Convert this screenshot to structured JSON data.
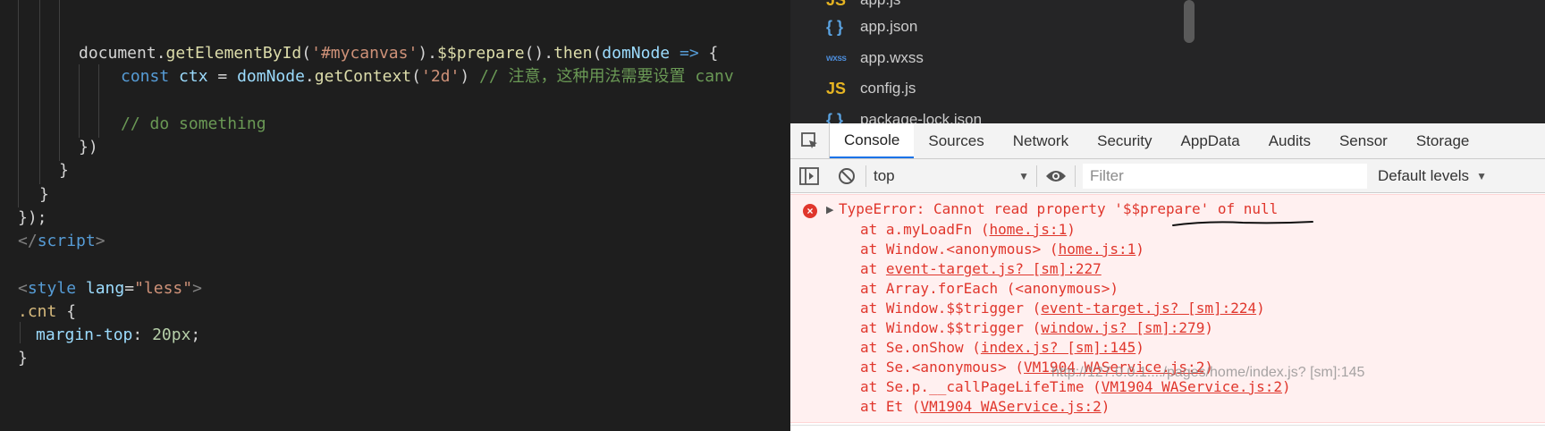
{
  "editor": {
    "lines": [
      {
        "tokens": []
      },
      {
        "tokens": []
      },
      {
        "tokens": [
          {
            "t": "document",
            "c": "plain"
          },
          {
            "t": ".",
            "c": "plain"
          },
          {
            "t": "getElementById",
            "c": "fn"
          },
          {
            "t": "(",
            "c": "plain"
          },
          {
            "t": "'#mycanvas'",
            "c": "str"
          },
          {
            "t": ").",
            "c": "plain"
          },
          {
            "t": "$$prepare",
            "c": "fn"
          },
          {
            "t": "().",
            "c": "plain"
          },
          {
            "t": "then",
            "c": "fn"
          },
          {
            "t": "(",
            "c": "plain"
          },
          {
            "t": "domNode",
            "c": "var"
          },
          {
            "t": " => ",
            "c": "kw"
          },
          {
            "t": "{",
            "c": "plain"
          }
        ]
      },
      {
        "tokens": [
          {
            "t": "const",
            "c": "kw"
          },
          {
            "t": " ",
            "c": "plain"
          },
          {
            "t": "ctx",
            "c": "var"
          },
          {
            "t": " = ",
            "c": "plain"
          },
          {
            "t": "domNode",
            "c": "var"
          },
          {
            "t": ".",
            "c": "plain"
          },
          {
            "t": "getContext",
            "c": "fn"
          },
          {
            "t": "(",
            "c": "plain"
          },
          {
            "t": "'2d'",
            "c": "str"
          },
          {
            "t": ") ",
            "c": "plain"
          },
          {
            "t": "// 注意，这种用法需要设置 canv",
            "c": "cmt"
          }
        ]
      },
      {
        "tokens": []
      },
      {
        "tokens": [
          {
            "t": "// do something",
            "c": "cmt"
          }
        ]
      },
      {
        "tokens": [
          {
            "t": "})",
            "c": "plain"
          }
        ]
      },
      {
        "tokens": [
          {
            "t": "}",
            "c": "plain"
          }
        ]
      },
      {
        "tokens": [
          {
            "t": "}",
            "c": "plain"
          }
        ]
      },
      {
        "tokens": [
          {
            "t": "});",
            "c": "plain"
          }
        ]
      },
      {
        "tokens": [
          {
            "t": "</",
            "c": "tag"
          },
          {
            "t": "script",
            "c": "tagname"
          },
          {
            "t": ">",
            "c": "tag"
          }
        ]
      },
      {
        "tokens": []
      },
      {
        "tokens": [
          {
            "t": "<",
            "c": "tag"
          },
          {
            "t": "style",
            "c": "tagname"
          },
          {
            "t": " ",
            "c": "plain"
          },
          {
            "t": "lang",
            "c": "attr"
          },
          {
            "t": "=",
            "c": "plain"
          },
          {
            "t": "\"less\"",
            "c": "str"
          },
          {
            "t": ">",
            "c": "tag"
          }
        ]
      },
      {
        "tokens": [
          {
            "t": ".cnt",
            "c": "sel"
          },
          {
            "t": " {",
            "c": "plain"
          }
        ]
      },
      {
        "tokens": [
          {
            "t": "margin-top",
            "c": "attr"
          },
          {
            "t": ": ",
            "c": "plain"
          },
          {
            "t": "20px",
            "c": "num"
          },
          {
            "t": ";",
            "c": "plain"
          }
        ]
      },
      {
        "tokens": [
          {
            "t": "}",
            "c": "plain"
          }
        ]
      }
    ]
  },
  "filetree": {
    "items": [
      {
        "name": "app.js",
        "icon": "JS",
        "type": "js"
      },
      {
        "name": "app.json",
        "icon": "{ }",
        "type": "json"
      },
      {
        "name": "app.wxss",
        "icon": "wxss",
        "type": "wxss"
      },
      {
        "name": "config.js",
        "icon": "JS",
        "type": "js"
      },
      {
        "name": "package-lock.json",
        "icon": "{ }",
        "type": "json"
      }
    ]
  },
  "devtools": {
    "tabs": [
      "Console",
      "Sources",
      "Network",
      "Security",
      "AppData",
      "Audits",
      "Sensor",
      "Storage"
    ],
    "active_tab": "Console",
    "toolbar": {
      "context": "top",
      "filter_placeholder": "Filter",
      "levels": "Default levels"
    },
    "error": {
      "prefix": "TypeError: Cannot read property ",
      "highlight": "'$$prepare'",
      "suffix": " of null",
      "stack": [
        {
          "pre": "at a.myLoadFn (",
          "link": "home.js:1",
          "post": ")"
        },
        {
          "pre": "at Window.<anonymous> (",
          "link": "home.js:1",
          "post": ")"
        },
        {
          "pre": "at ",
          "link": "event-target.js? [sm]:227",
          "post": ""
        },
        {
          "pre": "at Array.forEach (<anonymous>)",
          "link": "",
          "post": ""
        },
        {
          "pre": "at Window.$$trigger (",
          "link": "event-target.js? [sm]:224",
          "post": ")"
        },
        {
          "pre": "at Window.$$trigger (",
          "link": "window.js? [sm]:279",
          "post": ")"
        },
        {
          "pre": "at Se.onShow (",
          "link": "index.js? [sm]:145",
          "post": ")"
        },
        {
          "pre": "at Se.<anonymous> (",
          "link": "VM1904 WAService.js:2",
          "post": ")"
        },
        {
          "pre": "at Se.p.__callPageLifeTime (",
          "link": "VM1904 WAService.js:2",
          "post": ")"
        },
        {
          "pre": "at Et (",
          "link": "VM1904 WAService.js:2",
          "post": ")"
        }
      ],
      "hover_tooltip": "http://127.0.0.1:.../pages/home/index.js? [sm]:145"
    }
  },
  "colors": {
    "error_red": "#e0362c",
    "error_bg": "#fff0f0",
    "active_tab_underline": "#1a73e8",
    "editor_bg": "#1e1e1e"
  }
}
